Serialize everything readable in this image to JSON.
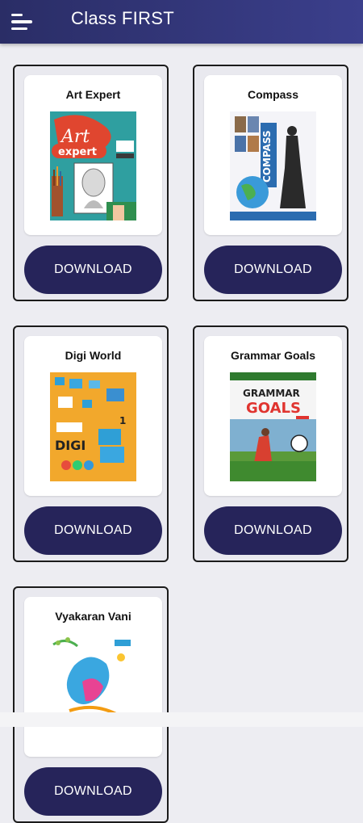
{
  "header": {
    "title": "Class FIRST",
    "menu_icon": "hamburger-menu-icon"
  },
  "books": [
    {
      "title": "Art Expert",
      "button": "DOWNLOAD",
      "cover_text": [
        "Art",
        "expert"
      ]
    },
    {
      "title": "Compass",
      "button": "DOWNLOAD",
      "cover_text": [
        "COMPASS"
      ]
    },
    {
      "title": "Digi World",
      "button": "DOWNLOAD",
      "cover_text": [
        "DIGI",
        "1"
      ]
    },
    {
      "title": "Grammar Goals",
      "button": "DOWNLOAD",
      "cover_text": [
        "GRAMMAR",
        "GOALS",
        "1"
      ]
    },
    {
      "title": "Vyakaran Vani",
      "button": "DOWNLOAD",
      "cover_text": []
    }
  ],
  "colors": {
    "app_bar": "#2a2d66",
    "button": "#26245a",
    "background": "#ededf2"
  }
}
